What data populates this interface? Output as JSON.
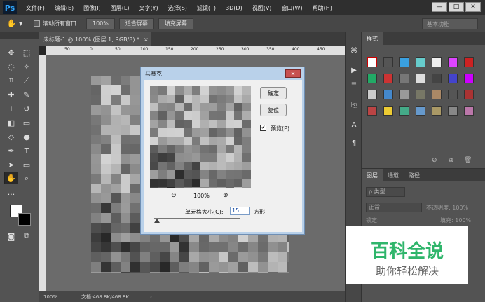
{
  "app": {
    "logo": "Ps"
  },
  "menu": [
    "文件(F)",
    "编辑(E)",
    "图像(I)",
    "图层(L)",
    "文字(Y)",
    "选择(S)",
    "滤镜(T)",
    "3D(D)",
    "视图(V)",
    "窗口(W)",
    "帮助(H)"
  ],
  "window_buttons": {
    "minimize": "—",
    "maximize": "□",
    "close": "✕"
  },
  "options_bar": {
    "scroll_all_label": "滚动所有窗口",
    "zoom_btn": "100%",
    "fit_screen_btn": "适合屏幕",
    "fill_screen_btn": "填充屏幕",
    "workspace": "基本功能"
  },
  "document": {
    "tab_title": "未标题-1 @ 100% (图层 1, RGB/8) *",
    "tab_close": "×",
    "ruler_marks": [
      "50",
      "0",
      "50",
      "100",
      "150",
      "200",
      "250",
      "300",
      "350",
      "400",
      "450"
    ],
    "status_zoom": "100%",
    "status_doc": "文档:468.8K/468.8K"
  },
  "dialog": {
    "title": "马赛克",
    "close": "✕",
    "ok": "确定",
    "reset": "复位",
    "preview_label": "预览(P)",
    "preview_checked": "✔",
    "zoom_out": "⊖",
    "zoom_level": "100%",
    "zoom_in": "⊕",
    "cell_size_label": "单元格大小(C):",
    "cell_size_value": "15",
    "unit": "方形"
  },
  "styles_panel": {
    "tab": "样式"
  },
  "layers_panel": {
    "tabs": [
      "图层",
      "通道",
      "路径"
    ],
    "filter_label": "ρ 类型",
    "blend_mode": "正常",
    "opacity_label": "不透明度: 100%",
    "lock_label": "锁定:",
    "fill_label": "填充: 100%"
  },
  "watermark": {
    "title": "百科全说",
    "subtitle": "助你轻松解决"
  }
}
